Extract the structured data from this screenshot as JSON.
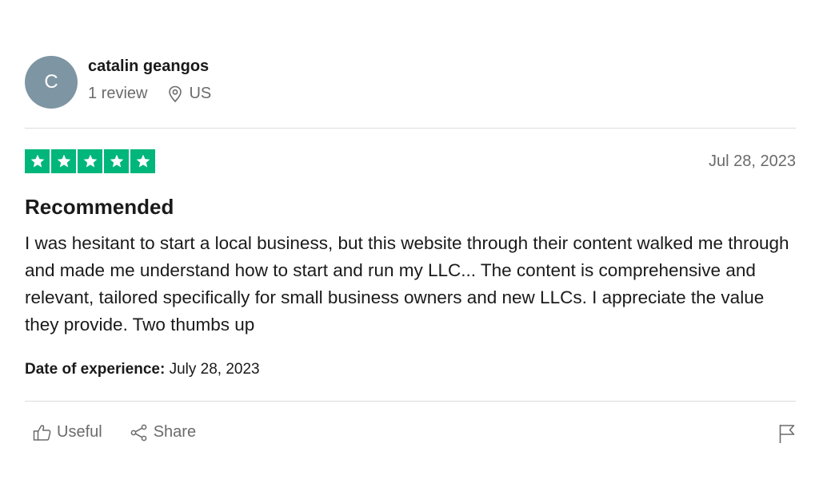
{
  "reviewer": {
    "avatar_initial": "C",
    "avatar_color": "#7e95a3",
    "name": "catalin geangos",
    "review_count": "1 review",
    "location_icon": "map-pin-icon",
    "country": "US"
  },
  "review": {
    "rating": 5,
    "max_rating": 5,
    "star_color": "#00b67a",
    "date": "Jul 28, 2023",
    "title": "Recommended",
    "body": "I was hesitant to start a local business, but this website through their content walked me through and made me understand how to start and run my LLC... The content is comprehensive and relevant, tailored specifically for small business owners and new LLCs. I appreciate the value they provide. Two thumbs up",
    "experience_label": "Date of experience:",
    "experience_date": "July 28, 2023"
  },
  "actions": {
    "useful_label": "Useful",
    "useful_icon": "thumbs-up-icon",
    "share_label": "Share",
    "share_icon": "share-icon",
    "flag_icon": "flag-icon"
  }
}
